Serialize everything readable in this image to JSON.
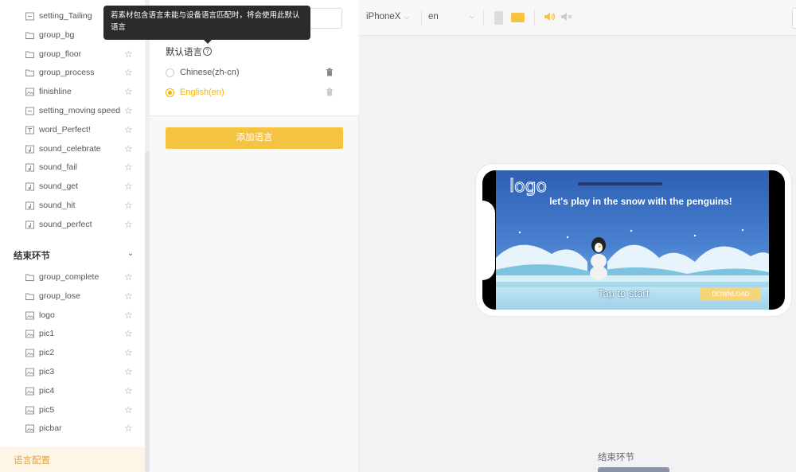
{
  "sidebar": {
    "items_top": [
      {
        "name": "setting_Tailing",
        "icon": "setting-icon"
      },
      {
        "name": "group_bg",
        "icon": "folder-icon"
      },
      {
        "name": "group_floor",
        "icon": "folder-icon"
      },
      {
        "name": "group_process",
        "icon": "folder-icon"
      },
      {
        "name": "finishline",
        "icon": "image-icon"
      },
      {
        "name": "setting_moving speed",
        "icon": "setting-icon"
      },
      {
        "name": "word_Perfect!",
        "icon": "text-icon"
      },
      {
        "name": "sound_celebrate",
        "icon": "sound-icon"
      },
      {
        "name": "sound_fail",
        "icon": "sound-icon"
      },
      {
        "name": "sound_get",
        "icon": "sound-icon"
      },
      {
        "name": "sound_hit",
        "icon": "sound-icon"
      },
      {
        "name": "sound_perfect",
        "icon": "sound-icon"
      }
    ],
    "section_title": "结束环节",
    "items_bottom": [
      {
        "name": "group_complete",
        "icon": "folder-icon"
      },
      {
        "name": "group_lose",
        "icon": "folder-icon"
      },
      {
        "name": "logo",
        "icon": "image-icon"
      },
      {
        "name": "pic1",
        "icon": "image-icon"
      },
      {
        "name": "pic2",
        "icon": "image-icon"
      },
      {
        "name": "pic3",
        "icon": "image-icon"
      },
      {
        "name": "pic4",
        "icon": "image-icon"
      },
      {
        "name": "pic5",
        "icon": "image-icon"
      },
      {
        "name": "picbar",
        "icon": "image-icon"
      }
    ],
    "lang_config": "语言配置"
  },
  "tooltip": {
    "text": "若素材包含语言未能与设备语言匹配时，将会使用此默认语言"
  },
  "language_panel": {
    "default_label": "默认语言",
    "languages": [
      {
        "label": "Chinese(zh-cn)",
        "selected": false
      },
      {
        "label": "English(en)",
        "selected": true
      }
    ],
    "add_button": "添加语言"
  },
  "toolbar": {
    "device": "iPhoneX",
    "language": "en"
  },
  "preview": {
    "logo": "logo",
    "headline": "let's play in the snow with the penguins!",
    "tap": "Tap to start",
    "download": "DOWNLOAD"
  },
  "bottom_label": "结束环节",
  "colors": {
    "accent": "#f5c342",
    "selected": "#f5b400",
    "lang_config_bg": "#fdf5e6"
  }
}
